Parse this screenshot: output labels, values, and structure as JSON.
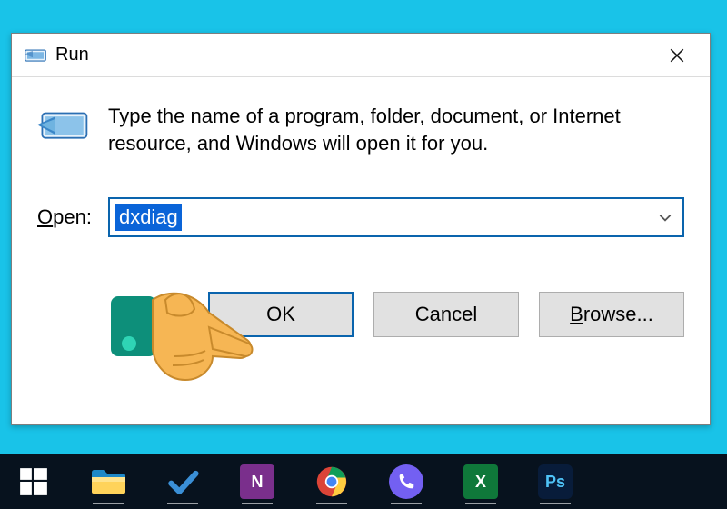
{
  "dialog": {
    "title": "Run",
    "description": "Type the name of a program, folder, document, or Internet resource, and Windows will open it for you.",
    "open_label_prefix": "O",
    "open_label_rest": "pen:",
    "input_value": "dxdiag",
    "buttons": {
      "ok": "OK",
      "cancel": "Cancel",
      "browse_accel": "B",
      "browse_rest": "rowse..."
    }
  },
  "taskbar": {
    "items": [
      {
        "name": "start",
        "kind": "start"
      },
      {
        "name": "file-explorer",
        "kind": "explorer"
      },
      {
        "name": "todo",
        "kind": "todo"
      },
      {
        "name": "onenote",
        "kind": "tile",
        "letter": "N",
        "tile": "onenote"
      },
      {
        "name": "chrome",
        "kind": "chrome"
      },
      {
        "name": "viber",
        "kind": "tile",
        "letter": "✆",
        "tile": "viber"
      },
      {
        "name": "excel",
        "kind": "tile",
        "letter": "X",
        "tile": "excel"
      },
      {
        "name": "photoshop",
        "kind": "tile",
        "letter": "Ps",
        "tile": "ps"
      }
    ]
  }
}
